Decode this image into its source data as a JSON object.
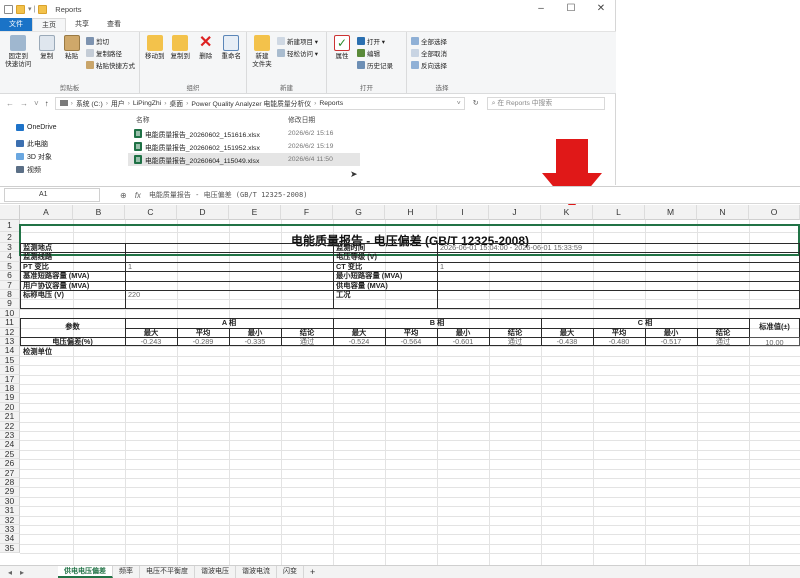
{
  "explorer": {
    "title": "Reports",
    "ribbon_tabs": [
      "文件",
      "主页",
      "共享",
      "查看"
    ],
    "groups": {
      "clipboard": {
        "name": "剪贴板",
        "pin": "固定到\n快速访问",
        "copy": "复制",
        "paste": "粘贴",
        "cut": "剪切",
        "copy_path": "复制路径",
        "paste_shortcut": "粘贴快捷方式"
      },
      "organize": {
        "name": "组织",
        "move_to": "移动到",
        "copy_to": "复制到",
        "delete": "删除",
        "rename": "重命名"
      },
      "new": {
        "name": "新建",
        "new_folder": "新建\n文件夹",
        "new_item": "新建项目 ▾",
        "easy_access": "轻松访问 ▾"
      },
      "open": {
        "name": "打开",
        "properties": "属性",
        "open": "打开 ▾",
        "edit": "编辑",
        "history": "历史记录"
      },
      "select": {
        "name": "选择",
        "select_all": "全部选择",
        "select_none": "全部取消",
        "invert": "反向选择"
      }
    },
    "address": [
      "系统 (C:)",
      "用户",
      "LiPingZhi",
      "桌面",
      "Power Quality Analyzer 电能质量分析仪",
      "Reports"
    ],
    "search_placeholder": "在 Reports 中搜索",
    "nav": [
      "OneDrive",
      "此电脑",
      "3D 对象",
      "视频"
    ],
    "columns": {
      "name": "名称",
      "date": "修改日期"
    },
    "files": [
      {
        "name": "电能质量报告_20260602_151616.xlsx",
        "date": "2026/6/2 15:16"
      },
      {
        "name": "电能质量报告_20260602_151952.xlsx",
        "date": "2026/6/2 15:19"
      },
      {
        "name": "电能质量报告_20260604_115049.xlsx",
        "date": "2026/6/4 11:50"
      }
    ]
  },
  "formula_bar": {
    "cell": "A1",
    "fx": "fx",
    "content": "电能质量报告 - 电压偏差 (GB/T 12325-2008)"
  },
  "sheet": {
    "columns": [
      "A",
      "B",
      "C",
      "D",
      "E",
      "F",
      "G",
      "H",
      "I",
      "J",
      "K",
      "L",
      "M",
      "N",
      "O"
    ],
    "rows": [
      "1",
      "2",
      "3",
      "4",
      "5",
      "6",
      "7",
      "8",
      "9",
      "10",
      "11",
      "12",
      "13",
      "14",
      "15",
      "16",
      "17",
      "18",
      "19",
      "20",
      "21",
      "22",
      "23",
      "24",
      "25",
      "26",
      "27",
      "28",
      "29",
      "30",
      "31",
      "32",
      "33",
      "34",
      "35"
    ],
    "title": "电能质量报告 - 电压偏差 (GB/T 12325-2008)",
    "info_left": [
      {
        "label": "监测地点",
        "value": ""
      },
      {
        "label": "监测线路",
        "value": ""
      },
      {
        "label": "PT 变比",
        "value": "1"
      },
      {
        "label": "基准短路容量 (MVA)",
        "value": ""
      },
      {
        "label": "用户协议容量 (MVA)",
        "value": ""
      },
      {
        "label": "标称电压 (V)",
        "value": "220"
      }
    ],
    "info_right": [
      {
        "label": "监测时间",
        "value": "2026-06-01 15:04:00 - 2026-06-01 15:33:59"
      },
      {
        "label": "电压等级 (V)",
        "value": ""
      },
      {
        "label": "CT 变比",
        "value": "1"
      },
      {
        "label": "最小短路容量 (MVA)",
        "value": ""
      },
      {
        "label": "供电容量 (MVA)",
        "value": ""
      },
      {
        "label": "工况",
        "value": ""
      }
    ],
    "param_label": "参数",
    "phases": [
      "A 相",
      "B 相",
      "C 相"
    ],
    "sub_headers": [
      "最大",
      "平均",
      "最小",
      "结论"
    ],
    "standard_label": "标准值(±)",
    "data_row": {
      "label": "电压偏差(%)",
      "a": [
        "-0.243",
        "-0.289",
        "-0.335",
        "通过"
      ],
      "b": [
        "-0.524",
        "-0.564",
        "-0.601",
        "通过"
      ],
      "c": [
        "-0.438",
        "-0.480",
        "-0.517",
        "通过"
      ],
      "standard": "10.00"
    },
    "unit_label": "检测单位"
  },
  "sheet_tabs": [
    "供电电压偏差",
    "频率",
    "电压不平衡度",
    "谐波电压",
    "谐波电流",
    "闪变"
  ],
  "active_tab": 0
}
